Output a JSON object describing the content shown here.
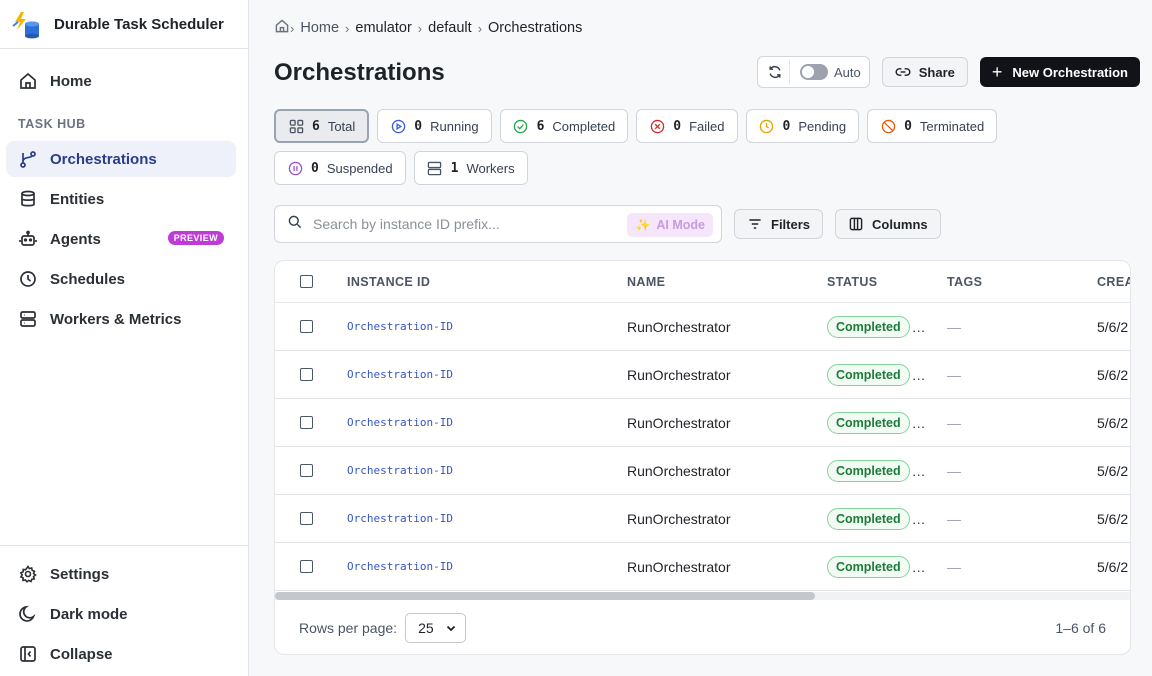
{
  "brand": {
    "title": "Durable Task Scheduler"
  },
  "sidebar": {
    "home": "Home",
    "section": "TASK HUB",
    "items": [
      {
        "label": "Orchestrations",
        "icon": "branch-icon"
      },
      {
        "label": "Entities",
        "icon": "database-icon"
      },
      {
        "label": "Agents",
        "icon": "bot-icon",
        "badge": "PREVIEW"
      },
      {
        "label": "Schedules",
        "icon": "clock-icon"
      },
      {
        "label": "Workers & Metrics",
        "icon": "server-icon"
      }
    ],
    "bottom": [
      {
        "label": "Settings",
        "icon": "gear-icon"
      },
      {
        "label": "Dark mode",
        "icon": "moon-icon"
      },
      {
        "label": "Collapse",
        "icon": "collapse-icon"
      }
    ]
  },
  "breadcrumb": [
    "Home",
    "emulator",
    "default",
    "Orchestrations"
  ],
  "page": {
    "title": "Orchestrations"
  },
  "actions": {
    "auto_label": "Auto",
    "share_label": "Share",
    "new_label": "New Orchestration"
  },
  "stats": [
    {
      "count": "6",
      "label": "Total",
      "icon": "grid-icon"
    },
    {
      "count": "0",
      "label": "Running",
      "icon": "play-icon"
    },
    {
      "count": "6",
      "label": "Completed",
      "icon": "check-circle-icon"
    },
    {
      "count": "0",
      "label": "Failed",
      "icon": "x-circle-icon"
    },
    {
      "count": "0",
      "label": "Pending",
      "icon": "clock-icon"
    },
    {
      "count": "0",
      "label": "Terminated",
      "icon": "ban-icon"
    },
    {
      "count": "0",
      "label": "Suspended",
      "icon": "pause-icon"
    },
    {
      "count": "1",
      "label": "Workers",
      "icon": "server-icon"
    }
  ],
  "search": {
    "placeholder": "Search by instance ID prefix...",
    "ai_label": "AI Mode"
  },
  "toolbar": {
    "filters_label": "Filters",
    "columns_label": "Columns"
  },
  "table": {
    "headers": [
      "INSTANCE ID",
      "NAME",
      "STATUS",
      "TAGS",
      "CREAT"
    ],
    "rows": [
      {
        "id": "Orchestration-ID",
        "name": "RunOrchestrator",
        "status": "Completed",
        "tags": "—",
        "created": "5/6/2"
      },
      {
        "id": "Orchestration-ID",
        "name": "RunOrchestrator",
        "status": "Completed",
        "tags": "—",
        "created": "5/6/2"
      },
      {
        "id": "Orchestration-ID",
        "name": "RunOrchestrator",
        "status": "Completed",
        "tags": "—",
        "created": "5/6/2"
      },
      {
        "id": "Orchestration-ID",
        "name": "RunOrchestrator",
        "status": "Completed",
        "tags": "—",
        "created": "5/6/2"
      },
      {
        "id": "Orchestration-ID",
        "name": "RunOrchestrator",
        "status": "Completed",
        "tags": "—",
        "created": "5/6/2"
      },
      {
        "id": "Orchestration-ID",
        "name": "RunOrchestrator",
        "status": "Completed",
        "tags": "—",
        "created": "5/6/2"
      }
    ]
  },
  "footer": {
    "rows_label": "Rows per page:",
    "rows_value": "25",
    "range": "1–6 of 6"
  }
}
